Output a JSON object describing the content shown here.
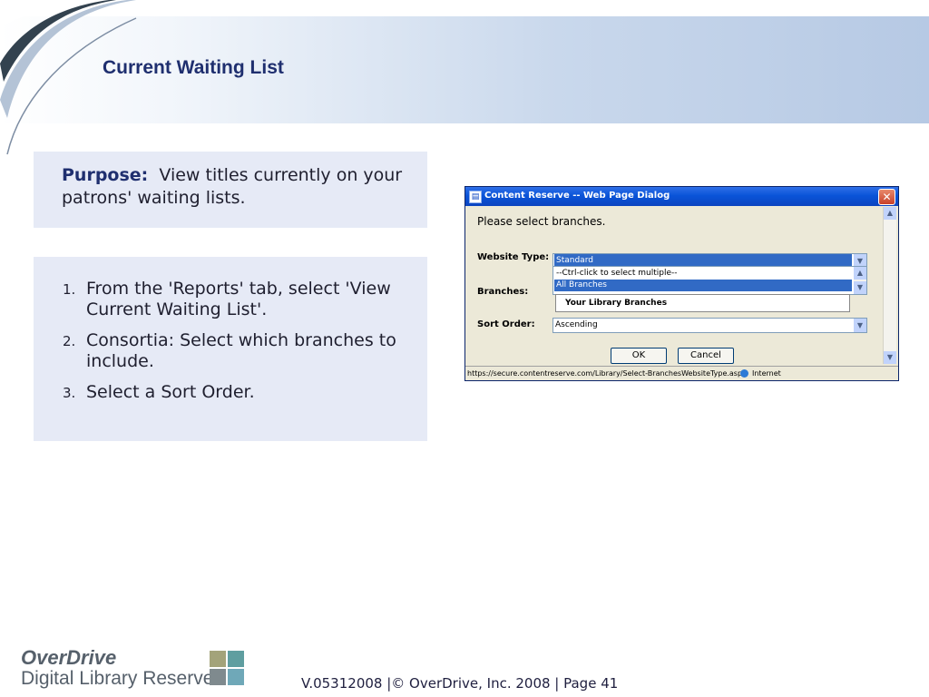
{
  "slide": {
    "title": "Current Waiting List"
  },
  "purpose": {
    "label": "Purpose:",
    "text": "View titles currently on your patrons' waiting lists."
  },
  "steps": [
    {
      "num": "1.",
      "text": "From the 'Reports' tab, select 'View Current Waiting List'."
    },
    {
      "num": "2.",
      "text": "Consortia:  Select which branches to include."
    },
    {
      "num": "3.",
      "text": "Select a Sort Order."
    }
  ],
  "dialog": {
    "title": "Content Reserve -- Web Page Dialog",
    "heading": "Please select branches.",
    "website_type_label": "Website Type:",
    "website_type_value": "Standard",
    "branches_label": "Branches:",
    "branches_options": [
      "--Ctrl-click to select multiple--",
      "All Branches"
    ],
    "branches_popup": "Your Library Branches",
    "sort_order_label": "Sort Order:",
    "sort_order_value": "Ascending",
    "ok_label": "OK",
    "cancel_label": "Cancel",
    "status_url": "https://secure.contentreserve.com/Library/Select-BranchesWebsiteType.asp",
    "status_zone": "Internet"
  },
  "footer": {
    "logo_brand": "OverDrive",
    "logo_sub": "Digital Library Reserve",
    "info": "V.05312008 |© OverDrive, Inc. 2008   |  Page 41"
  },
  "colors": {
    "title": "#1f2f6f",
    "panel": "#e6eaf6",
    "logo_square_1": "#a3a37a",
    "logo_square_2": "#5f9ea0",
    "logo_square_3": "#7f8a8e",
    "logo_square_4": "#6fa8b8"
  }
}
